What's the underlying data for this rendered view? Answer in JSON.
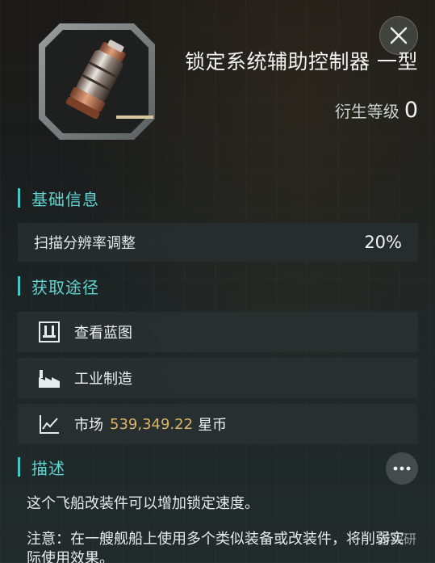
{
  "item": {
    "title": "锁定系统辅助控制器 一型",
    "tier_label": "衍生等级",
    "tier_value": "0",
    "icon": "canister-module-icon"
  },
  "close": {
    "icon": "close-icon"
  },
  "sections": {
    "basic_info": "基础信息",
    "acquisition": "获取途径",
    "description": "描述"
  },
  "stats": [
    {
      "label": "扫描分辨率调整",
      "value": "20%"
    }
  ],
  "acquisition": {
    "blueprint": {
      "label": "查看蓝图",
      "icon": "blueprint-icon"
    },
    "industry": {
      "label": "工业制造",
      "icon": "factory-icon"
    },
    "market": {
      "label": "市场",
      "price": "539,349.22",
      "currency": "星币",
      "icon": "market-chart-icon"
    }
  },
  "more": {
    "icon": "more-dots-icon"
  },
  "description": {
    "text": "这个飞船改装件可以增加锁定速度。",
    "note": "注意：在一艘舰船上使用多个类似装备或改装件，将削弱实际使用效果。"
  },
  "watermark": "游戏研",
  "colors": {
    "accent": "#5fd5d2",
    "price": "#d8b566",
    "section_bar": "#43c8c8"
  }
}
